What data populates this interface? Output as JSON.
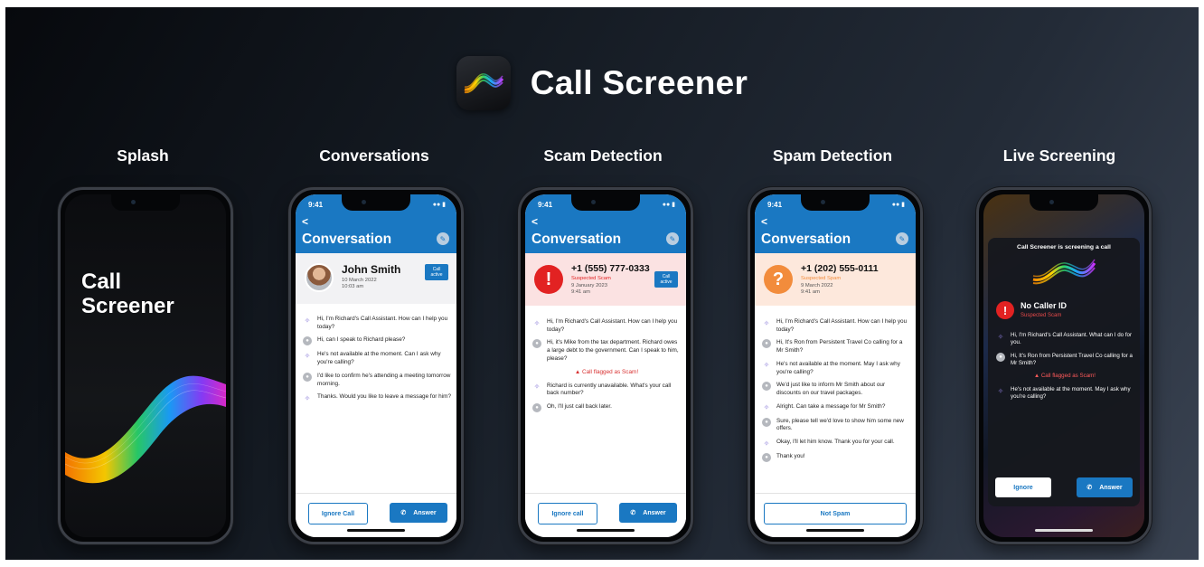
{
  "header": {
    "title": "Call Screener",
    "icon": "wave-logo-icon"
  },
  "columns": [
    "Splash",
    "Conversations",
    "Scam Detection",
    "Spam Detection",
    "Live Screening"
  ],
  "splash": {
    "title_line1": "Call",
    "title_line2": "Screener"
  },
  "colors": {
    "accent": "#1a78c2",
    "scam": "#e22222",
    "spam": "#f28c3c"
  },
  "conversations": {
    "time": "9:41",
    "back": "<",
    "title": "Conversation",
    "contact": {
      "name": "John Smith",
      "date": "10 March 2022",
      "time": "10:03 am",
      "badge_line1": "Call",
      "badge_line2": "active"
    },
    "messages": [
      {
        "who": "bot",
        "text": "Hi, I'm Richard's Call Assistant. How can I help you today?"
      },
      {
        "who": "user",
        "text": "Hi, can I speak to Richard please?"
      },
      {
        "who": "bot",
        "text": "He's not available at the moment. Can I ask why you're calling?"
      },
      {
        "who": "user",
        "text": "I'd like to confirm he's attending a meeting tomorrow morning."
      },
      {
        "who": "bot",
        "text": "Thanks. Would you like to leave a message for him?"
      }
    ],
    "ignore": "Ignore Call",
    "answer": "Answer"
  },
  "scam": {
    "time": "9:41",
    "back": "<",
    "title": "Conversation",
    "contact": {
      "number": "+1 (555) 777-0333",
      "status": "Suspected Scam",
      "date": "9 January 2023",
      "time": "9:41 am",
      "badge_line1": "Call",
      "badge_line2": "active"
    },
    "messages_before": [
      {
        "who": "bot",
        "text": "Hi, I'm Richard's Call Assistant. How can I help you today?"
      },
      {
        "who": "user",
        "text": "Hi, it's Mike from the tax department. Richard owes a large debt to the government. Can I speak to him, please?"
      }
    ],
    "flag": "Call flagged as Scam!",
    "messages_after": [
      {
        "who": "bot",
        "text": "Richard is currently unavailable. What's your call back number?"
      },
      {
        "who": "user",
        "text": "Oh, I'll just call back later."
      }
    ],
    "ignore": "Ignore call",
    "answer": "Answer"
  },
  "spam": {
    "time": "9:41",
    "back": "<",
    "title": "Conversation",
    "contact": {
      "number": "+1 (202) 555-0111",
      "status": "Suspected Spam",
      "date": "9 March 2022",
      "time": "9:41 am"
    },
    "messages": [
      {
        "who": "bot",
        "text": "Hi, I'm Richard's Call Assistant. How can I help you today?"
      },
      {
        "who": "user",
        "text": "Hi, It's Ron from Persistent Travel Co calling for a Mr Smith?"
      },
      {
        "who": "bot",
        "text": "He's not available at the moment. May I ask why you're calling?"
      },
      {
        "who": "user",
        "text": "We'd just like to inform Mr Smith about our discounts on our travel packages."
      },
      {
        "who": "bot",
        "text": "Alright. Can take a message for Mr Smith?"
      },
      {
        "who": "user",
        "text": "Sure, please tell we'd love to show him some new offers."
      },
      {
        "who": "bot",
        "text": "Okay, I'll let him know. Thank you for your call."
      },
      {
        "who": "user",
        "text": "Thank you!"
      }
    ],
    "not_spam": "Not Spam"
  },
  "live": {
    "heading": "Call Screener is screening a call",
    "caller": "No Caller ID",
    "status": "Suspected Scam",
    "messages_before": [
      {
        "who": "bot",
        "text": "Hi, I'm Richard's Call Assistant. What can I do for you."
      },
      {
        "who": "user",
        "text": "Hi, It's Ron from Persistent Travel Co calling for a Mr Smith?"
      }
    ],
    "flag": "Call flagged as Scam!",
    "messages_after": [
      {
        "who": "bot",
        "text": "He's not available at the moment. May I ask why you're calling?"
      }
    ],
    "ignore": "Ignore",
    "answer": "Answer"
  }
}
